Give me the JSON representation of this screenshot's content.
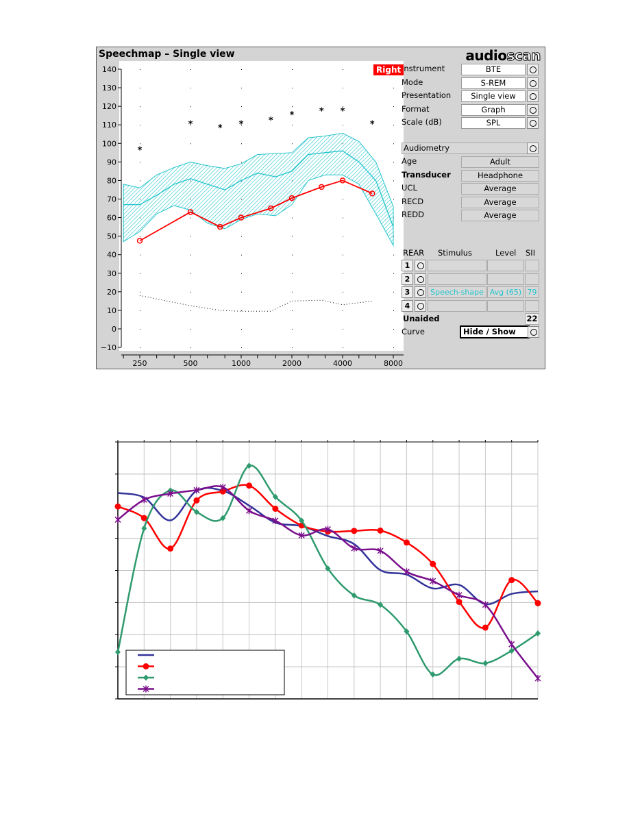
{
  "window": {
    "title": "Speechmap – Single view",
    "logo": "audioscan",
    "logo_bold": "audio",
    "logo_outline": "scan",
    "ear_badge": "Right",
    "ear_color": "#ff0000"
  },
  "settings": [
    {
      "label": "Instrument",
      "value": "BTE"
    },
    {
      "label": "Mode",
      "value": "S-REM"
    },
    {
      "label": "Presentation",
      "value": "Single view"
    },
    {
      "label": "Format",
      "value": "Graph"
    },
    {
      "label": "Scale (dB)",
      "value": "SPL"
    }
  ],
  "audiometry": {
    "label": "Audiometry",
    "rows": [
      {
        "label": "Age",
        "value": "Adult"
      },
      {
        "label": "Transducer",
        "value": "Headphone"
      },
      {
        "label": "UCL",
        "value": "Average"
      },
      {
        "label": "RECD",
        "value": "Average"
      },
      {
        "label": "REDD",
        "value": "Average"
      }
    ]
  },
  "rear": {
    "headers": [
      "REAR",
      "Stimulus",
      "Level",
      "SII"
    ],
    "rows": [
      {
        "num": "1",
        "stimulus": "",
        "level": "",
        "sii": ""
      },
      {
        "num": "2",
        "stimulus": "",
        "level": "",
        "sii": ""
      },
      {
        "num": "3",
        "stimulus": "Speech-shape",
        "level": "Avg (65)",
        "sii": "79"
      },
      {
        "num": "4",
        "stimulus": "",
        "level": "",
        "sii": ""
      }
    ],
    "unaided_label": "Unaided",
    "unaided_value": "22",
    "curve_label": "Curve",
    "curve_button": "Hide / Show"
  },
  "chart_data": [
    {
      "type": "line",
      "title": "",
      "xscale": "log",
      "xlim": [
        190,
        8500
      ],
      "ylim": [
        -10,
        140
      ],
      "xticks": [
        "250",
        "500",
        "1000",
        "2000",
        "4000",
        "8000"
      ],
      "yticks": [
        "140",
        "130",
        "120",
        "110",
        "100",
        "90",
        "80",
        "70",
        "60",
        "50",
        "40",
        "30",
        "20",
        "10",
        "0",
        "−10"
      ],
      "colors": {
        "band": "#22c4cc",
        "aided": "#ff0000",
        "ucl": "#000000",
        "threshold": "#000000"
      },
      "speech_band": {
        "freq": [
          200,
          250,
          315,
          400,
          500,
          630,
          800,
          1000,
          1250,
          1600,
          2000,
          2500,
          3150,
          4000,
          5000,
          6300,
          8000
        ],
        "upper": [
          78,
          76,
          83,
          87,
          90,
          88,
          86.5,
          89,
          94,
          94.5,
          95,
          103,
          104,
          105.5,
          101,
          90,
          66
        ],
        "median": [
          67,
          67,
          72,
          78,
          81,
          78,
          75,
          80,
          84,
          82,
          85,
          94,
          95,
          96,
          90,
          80,
          55
        ],
        "lower": [
          47,
          52.5,
          62,
          66.5,
          64,
          57,
          54,
          59,
          62,
          61,
          67,
          80,
          83,
          83,
          78,
          62,
          45
        ]
      },
      "aided": {
        "freq": [
          250,
          500,
          750,
          1000,
          1500,
          2000,
          3000,
          4000,
          6000
        ],
        "values": [
          47.5,
          63,
          55,
          60,
          65,
          70.5,
          76.5,
          80,
          73
        ]
      },
      "ucl": {
        "freq": [
          250,
          500,
          750,
          1000,
          1500,
          2000,
          3000,
          4000,
          6000
        ],
        "values": [
          97,
          111,
          109,
          111,
          113,
          116,
          118,
          118,
          111
        ]
      },
      "threshold": {
        "freq": [
          250,
          500,
          750,
          1000,
          1500,
          2000,
          3000,
          4000,
          6000
        ],
        "values": [
          18,
          12.5,
          10,
          9.5,
          9.5,
          15,
          15.5,
          13,
          15
        ]
      }
    },
    {
      "type": "line",
      "title": "",
      "ylim": [
        0,
        8
      ],
      "grid": true,
      "legend": "bottom-left",
      "x": [
        0,
        1,
        2,
        3,
        4,
        5,
        6,
        7,
        8,
        9,
        10,
        11,
        12,
        13,
        14,
        15,
        16
      ],
      "series": [
        {
          "color": "#33339a",
          "marker": "none",
          "values": [
            6.41,
            6.27,
            5.56,
            6.48,
            6.48,
            6.02,
            5.49,
            5.38,
            5.07,
            4.82,
            4.01,
            3.87,
            3.44,
            3.55,
            2.95,
            3.27,
            3.35
          ]
        },
        {
          "color": "#ff0000",
          "marker": "circle",
          "values": [
            5.99,
            5.63,
            4.68,
            6.18,
            6.46,
            6.64,
            5.92,
            5.4,
            5.21,
            5.23,
            5.24,
            4.87,
            4.2,
            3.02,
            2.22,
            3.7,
            2.98
          ]
        },
        {
          "color": "#2e9a6e",
          "marker": "diamond",
          "values": [
            1.46,
            5.31,
            6.49,
            5.82,
            5.63,
            7.26,
            6.29,
            5.55,
            4.06,
            3.22,
            2.93,
            2.1,
            0.76,
            1.25,
            1.11,
            1.5,
            2.04
          ]
        },
        {
          "color": "#7a0f8c",
          "marker": "star",
          "values": [
            5.58,
            6.2,
            6.39,
            6.5,
            6.59,
            5.86,
            5.55,
            5.09,
            5.28,
            4.69,
            4.61,
            3.96,
            3.67,
            3.23,
            2.93,
            1.7,
            0.64
          ]
        }
      ]
    }
  ]
}
